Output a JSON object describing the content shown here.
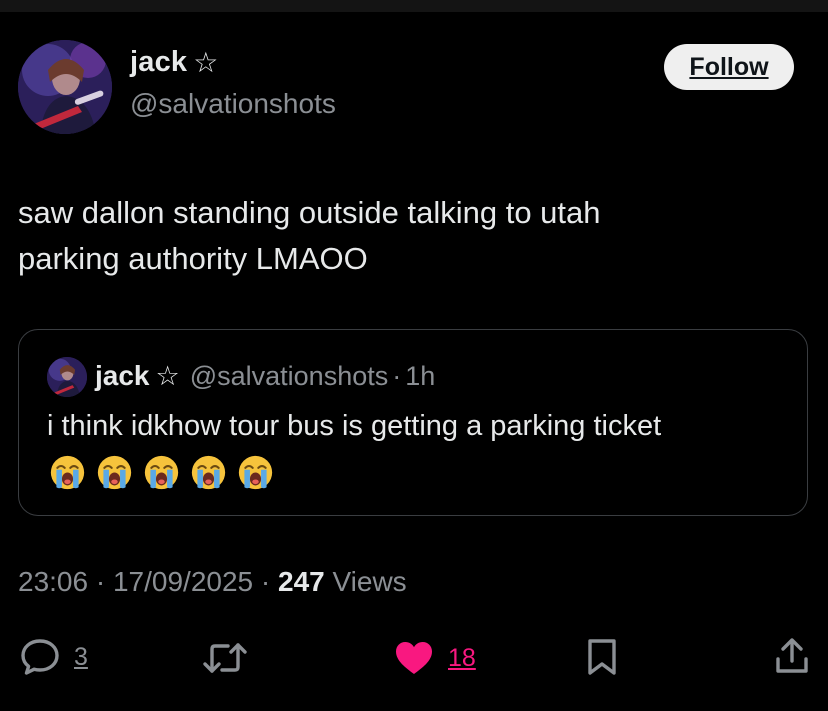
{
  "author": {
    "name": "jack",
    "badge_symbol": "☆",
    "handle": "@salvationshots",
    "avatar": "avatar-photo-guitarist-purple"
  },
  "follow_button": {
    "label": "Follow"
  },
  "tweet": {
    "text_line1": "saw dallon standing outside talking to utah",
    "text_line2": "parking authority LMAOO"
  },
  "quoted_tweet": {
    "name": "jack",
    "badge_symbol": "☆",
    "handle": "@salvationshots",
    "separator": "·",
    "time": "1h",
    "text": "i think idkhow tour bus is getting a parking ticket",
    "emoji": [
      "crying-face",
      "crying-face",
      "crying-face",
      "crying-face",
      "crying-face"
    ]
  },
  "meta": {
    "time": "23:06",
    "separator": "·",
    "date": "17/09/2025",
    "views_count": "247",
    "views_label": "Views"
  },
  "actions": {
    "reply_count": "3",
    "like_count": "18",
    "icons": [
      "reply-icon",
      "retweet-icon",
      "heart-icon",
      "bookmark-icon",
      "share-icon"
    ]
  },
  "colors": {
    "background": "#000000",
    "primary_text": "#e7e9ea",
    "secondary_text": "#8b8f94",
    "like_pink": "#f91880",
    "follow_bg": "#efefef",
    "quote_border": "#3a3d41"
  }
}
